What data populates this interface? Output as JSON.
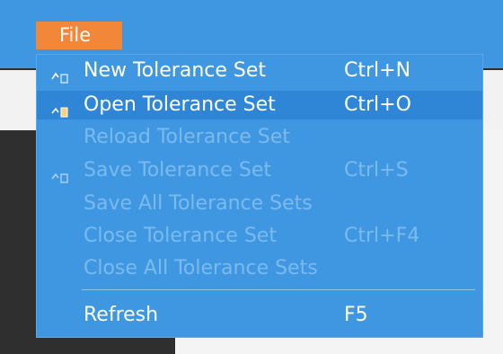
{
  "menu": {
    "title": "File",
    "items": [
      {
        "label": "New Tolerance Set",
        "shortcut": "Ctrl+N",
        "enabled": true,
        "icon": "new-doc-icon"
      },
      {
        "label": "Open Tolerance Set",
        "shortcut": "Ctrl+O",
        "enabled": true,
        "icon": "open-doc-icon"
      },
      {
        "label": "Reload Tolerance Set",
        "shortcut": "",
        "enabled": false
      },
      {
        "label": "Save Tolerance Set",
        "shortcut": "Ctrl+S",
        "enabled": false,
        "icon": "save-doc-icon"
      },
      {
        "label": "Save All Tolerance Sets",
        "shortcut": "",
        "enabled": false
      },
      {
        "label": "Close Tolerance Set",
        "shortcut": "Ctrl+F4",
        "enabled": false
      },
      {
        "label": "Close All Tolerance Sets",
        "shortcut": "",
        "enabled": false
      },
      {
        "label": "Refresh",
        "shortcut": "F5",
        "enabled": true
      }
    ]
  },
  "colors": {
    "menu_background": "#3f97e2",
    "title_highlight": "#f2873a",
    "text_enabled": "#ffffff",
    "text_disabled": "#8ec6f1"
  }
}
